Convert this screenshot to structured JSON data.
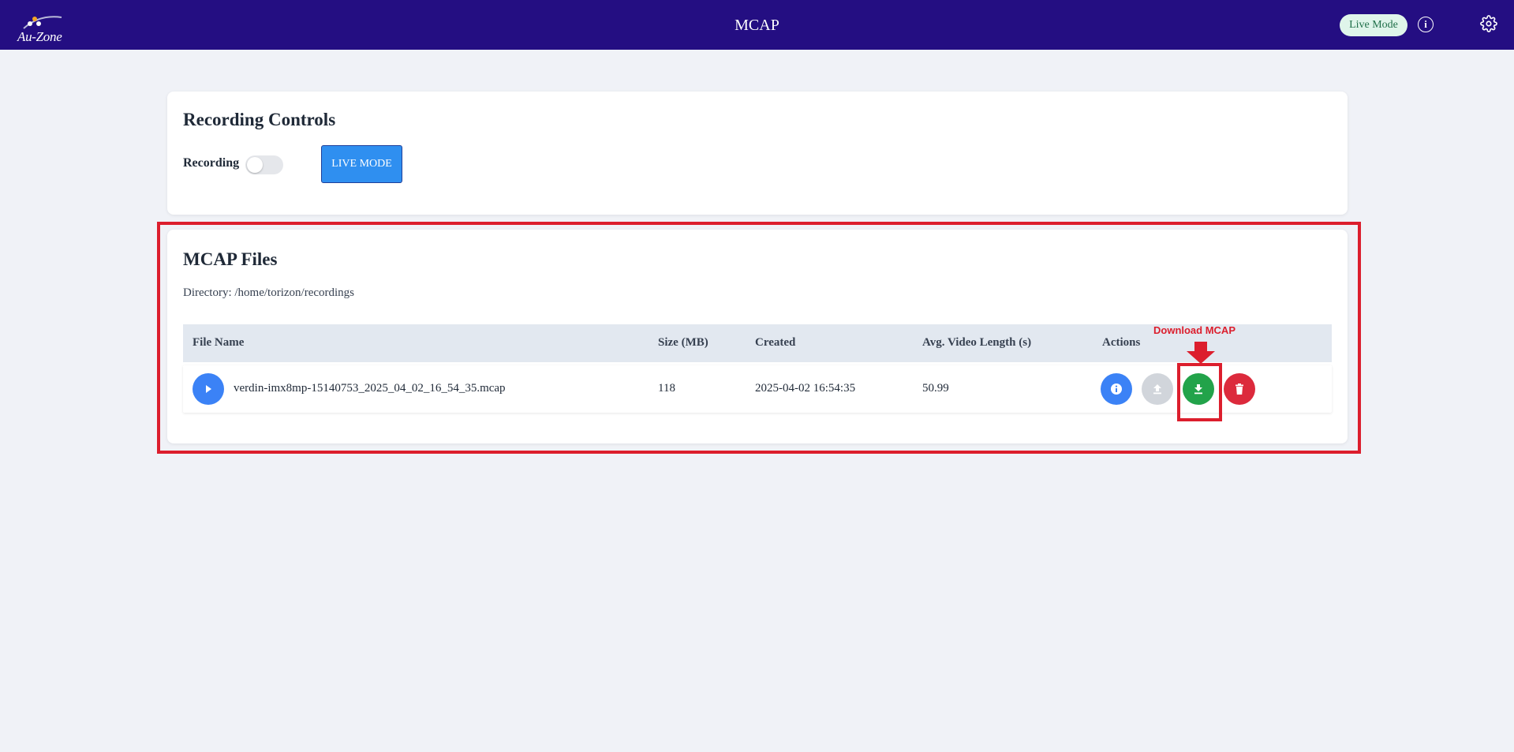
{
  "header": {
    "logo_text": "Au-Zone",
    "title": "MCAP",
    "mode_badge": "Live Mode",
    "info_glyph": "i",
    "icons": {
      "info": "info-icon",
      "settings": "gear-icon"
    }
  },
  "recording": {
    "title": "Recording Controls",
    "toggle_label": "Recording",
    "toggle_on": false,
    "live_mode_button": "LIVE MODE"
  },
  "files": {
    "title": "MCAP Files",
    "directory": "Directory: /home/torizon/recordings",
    "columns": [
      "File Name",
      "Size (MB)",
      "Created",
      "Avg. Video Length (s)",
      "Actions"
    ],
    "rows": [
      {
        "file_name": "verdin-imx8mp-15140753_2025_04_02_16_54_35.mcap",
        "size_mb": "118",
        "created": "2025-04-02 16:54:35",
        "avg_video_length": "50.99",
        "actions": [
          "info-icon",
          "upload-icon",
          "download-icon",
          "trash-icon"
        ]
      }
    ]
  },
  "annotation": {
    "label": "Download MCAP",
    "color": "#dc1e2d"
  },
  "colors": {
    "header_bg": "#240e82",
    "page_bg": "#f0f2f7",
    "primary_blue": "#3b82f6",
    "live_mode_blue": "#2f8ff0",
    "success_green": "#22a34a",
    "danger_red": "#dc2a3c",
    "disabled_gray": "#d1d5db"
  }
}
